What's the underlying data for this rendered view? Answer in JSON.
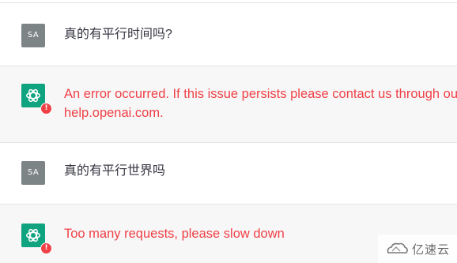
{
  "conversation": {
    "messages": [
      {
        "role": "user",
        "avatar_text": "SA",
        "text": "真的有平行时间吗?"
      },
      {
        "role": "assistant",
        "status": "error",
        "badge": "!",
        "text_line1": "An error occurred. If this issue persists please contact us through our",
        "text_line2": "help.openai.com."
      },
      {
        "role": "user",
        "avatar_text": "SA",
        "text": "真的有平行世界吗"
      },
      {
        "role": "assistant",
        "status": "error",
        "badge": "!",
        "text_line1": "Too many requests, please slow down"
      }
    ]
  },
  "watermark": {
    "text": "亿速云",
    "icon": "yisu-cloud-logo-icon"
  },
  "colors": {
    "assistant_bg": "#f7f7f8",
    "bot_avatar": "#10a37f",
    "user_avatar": "#7d8486",
    "error_text": "#ef4146"
  }
}
